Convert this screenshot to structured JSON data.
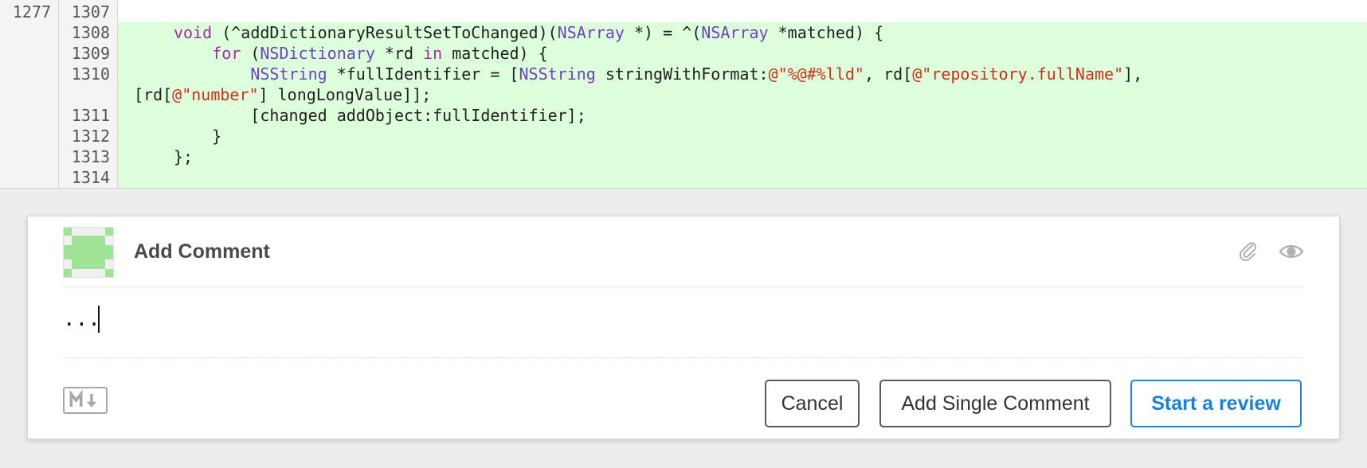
{
  "diff": {
    "lines": [
      {
        "old": "1277",
        "new": "1307",
        "parts": []
      },
      {
        "old": "",
        "new": "1308",
        "parts": [
          {
            "t": "void",
            "c": "kw"
          },
          {
            "t": " (^addDictionaryResultSetToChanged)(",
            "c": ""
          },
          {
            "t": "NSArray",
            "c": "ty"
          },
          {
            "t": " *) = ^(",
            "c": ""
          },
          {
            "t": "NSArray",
            "c": "ty"
          },
          {
            "t": " *matched) {",
            "c": ""
          }
        ]
      },
      {
        "old": "",
        "new": "1309",
        "parts": [
          {
            "t": "    ",
            "c": ""
          },
          {
            "t": "for",
            "c": "kw"
          },
          {
            "t": " (",
            "c": ""
          },
          {
            "t": "NSDictionary",
            "c": "ty"
          },
          {
            "t": " *rd ",
            "c": ""
          },
          {
            "t": "in",
            "c": "kw"
          },
          {
            "t": " matched) {",
            "c": ""
          }
        ]
      },
      {
        "old": "",
        "new": "1310",
        "parts": [
          {
            "t": "        ",
            "c": ""
          },
          {
            "t": "NSString",
            "c": "ty"
          },
          {
            "t": " *fullIdentifier = [",
            "c": ""
          },
          {
            "t": "NSString",
            "c": "ty"
          },
          {
            "t": " stringWithFormat:",
            "c": ""
          },
          {
            "t": "@\"%@#%lld\"",
            "c": "str"
          },
          {
            "t": ", rd[",
            "c": ""
          },
          {
            "t": "@\"repository.fullName\"",
            "c": "str"
          },
          {
            "t": "],",
            "c": ""
          }
        ]
      },
      {
        "old": "",
        "new": "",
        "wrap": true,
        "parts": [
          {
            "t": "[rd[",
            "c": ""
          },
          {
            "t": "@\"number\"",
            "c": "str"
          },
          {
            "t": "] longLongValue]];",
            "c": ""
          }
        ]
      },
      {
        "old": "",
        "new": "1311",
        "parts": [
          {
            "t": "        [changed addObject:fullIdentifier];",
            "c": ""
          }
        ]
      },
      {
        "old": "",
        "new": "1312",
        "parts": [
          {
            "t": "    }",
            "c": ""
          }
        ]
      },
      {
        "old": "",
        "new": "1313",
        "parts": [
          {
            "t": "};",
            "c": ""
          }
        ]
      },
      {
        "old": "",
        "new": "1314",
        "parts": []
      }
    ]
  },
  "comment": {
    "title": "Add Comment",
    "input_value": "...",
    "cancel_label": "Cancel",
    "add_single_label": "Add Single Comment",
    "start_review_label": "Start a review",
    "icons": {
      "avatar": "identicon-avatar",
      "attach": "paperclip-icon",
      "preview": "eye-icon",
      "markdown": "markdown-icon"
    }
  },
  "colors": {
    "added_line_bg": "#ddfedb",
    "keyword": "#a12aa6",
    "type": "#6f42c1",
    "string": "#d12f1b",
    "primary_blue": "#1b7fdd",
    "avatar_green": "#9fe397"
  }
}
